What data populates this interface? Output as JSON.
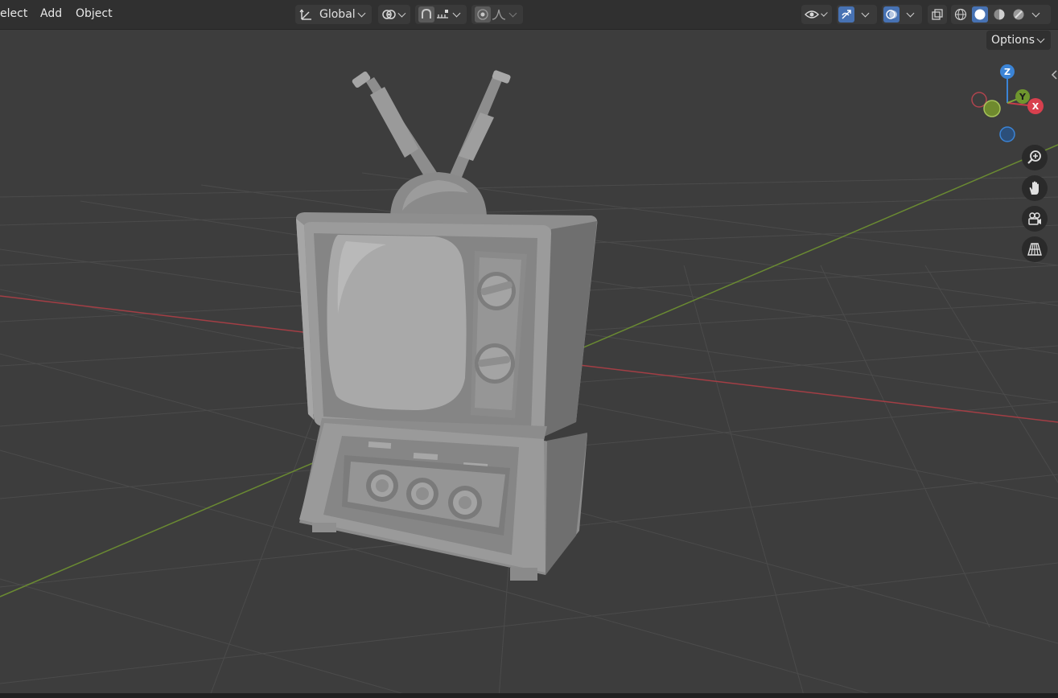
{
  "menu": {
    "select": "elect",
    "add": "Add",
    "object": "Object"
  },
  "header": {
    "transform_orientation": "Global",
    "options": "Options"
  },
  "gizmo": {
    "z": "Z",
    "y": "Y",
    "x": "X"
  },
  "colors": {
    "header_bg": "#303030",
    "viewport_bg": "#3d3d3d",
    "grid": "#4a4a4a",
    "x_axis": "#c0464e",
    "y_axis": "#7fa83a",
    "z_axis": "#3b84d6",
    "active": "#4772b3"
  },
  "icons": [
    "transform-orientation-icon",
    "pivot-icon",
    "snap-magnet-icon",
    "snap-increment-icon",
    "proportional-editing-icon",
    "falloff-curve-icon",
    "visibility-icon",
    "gizmo-icon",
    "overlay-icon",
    "xray-icon",
    "wireframe-shading-icon",
    "solid-shading-icon",
    "material-shading-icon",
    "rendered-shading-icon",
    "zoom-icon",
    "hand-pan-icon",
    "camera-icon",
    "perspective-grid-icon"
  ]
}
